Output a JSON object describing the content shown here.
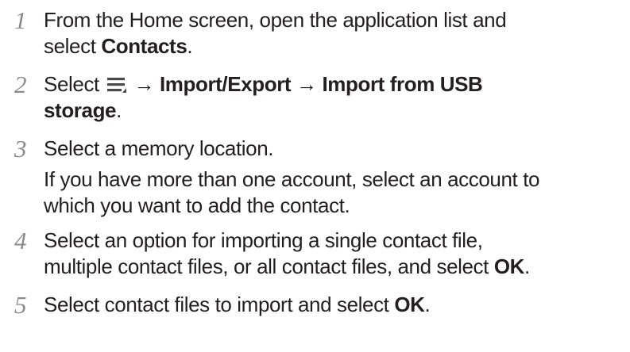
{
  "steps": [
    {
      "number": "1",
      "line1": "From the Home screen, open the application list and",
      "line2_pre": "select ",
      "line2_bold": "Contacts",
      "line2_post": "."
    },
    {
      "number": "2",
      "pre": "Select ",
      "icon": "menu-icon",
      "arrow1": " → ",
      "bold1": "Import/Export",
      "arrow2": " → ",
      "bold2a": "Import from USB",
      "bold2b": "storage",
      "post": "."
    },
    {
      "number": "3",
      "line1": "Select a memory location.",
      "line2": "If you have more than one account, select an account to",
      "line3": "which you want to add the contact."
    },
    {
      "number": "4",
      "line1": "Select an option for importing a single contact file,",
      "line2_pre": "multiple contact files, or all contact files, and select ",
      "line2_bold": "OK",
      "line2_post": "."
    },
    {
      "number": "5",
      "pre": "Select contact files to import and select ",
      "bold": "OK",
      "post": "."
    }
  ]
}
